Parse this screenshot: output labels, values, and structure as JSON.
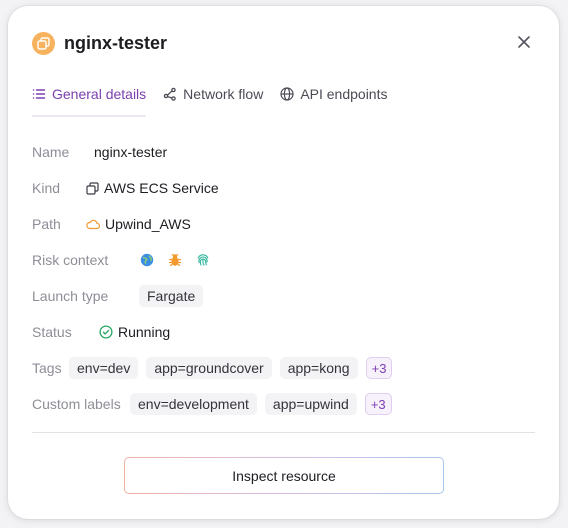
{
  "header": {
    "title": "nginx-tester",
    "icon": "copy-icon",
    "close_icon": "close-icon"
  },
  "tabs": [
    {
      "label": "General details",
      "icon": "list-icon",
      "active": true
    },
    {
      "label": "Network flow",
      "icon": "network-icon",
      "active": false
    },
    {
      "label": "API endpoints",
      "icon": "globe-icon",
      "active": false
    }
  ],
  "details": {
    "name": {
      "label": "Name",
      "value": "nginx-tester"
    },
    "kind": {
      "label": "Kind",
      "value": "AWS ECS Service",
      "icon": "copy-icon"
    },
    "path": {
      "label": "Path",
      "value": "Upwind_AWS",
      "icon": "cloud-icon"
    },
    "risk_context": {
      "label": "Risk context",
      "icons": [
        "internet-globe-icon",
        "bug-icon",
        "fingerprint-icon"
      ]
    },
    "launch_type": {
      "label": "Launch type",
      "value": "Fargate"
    },
    "status": {
      "label": "Status",
      "value": "Running",
      "icon": "check-circle-icon"
    },
    "tags": {
      "label": "Tags",
      "items": [
        "env=dev",
        "app=groundcover",
        "app=kong"
      ],
      "more": "+3"
    },
    "custom_labels": {
      "label": "Custom labels",
      "items": [
        "env=development",
        "app=upwind"
      ],
      "more": "+3"
    }
  },
  "actions": {
    "inspect_label": "Inspect resource"
  },
  "colors": {
    "accent": "#7b3fb0",
    "app_icon": "#f6b25c",
    "status_ok": "#2aa867",
    "globe": "#3a8ee6",
    "bug": "#f29a2e",
    "fingerprint": "#2bb39a"
  }
}
